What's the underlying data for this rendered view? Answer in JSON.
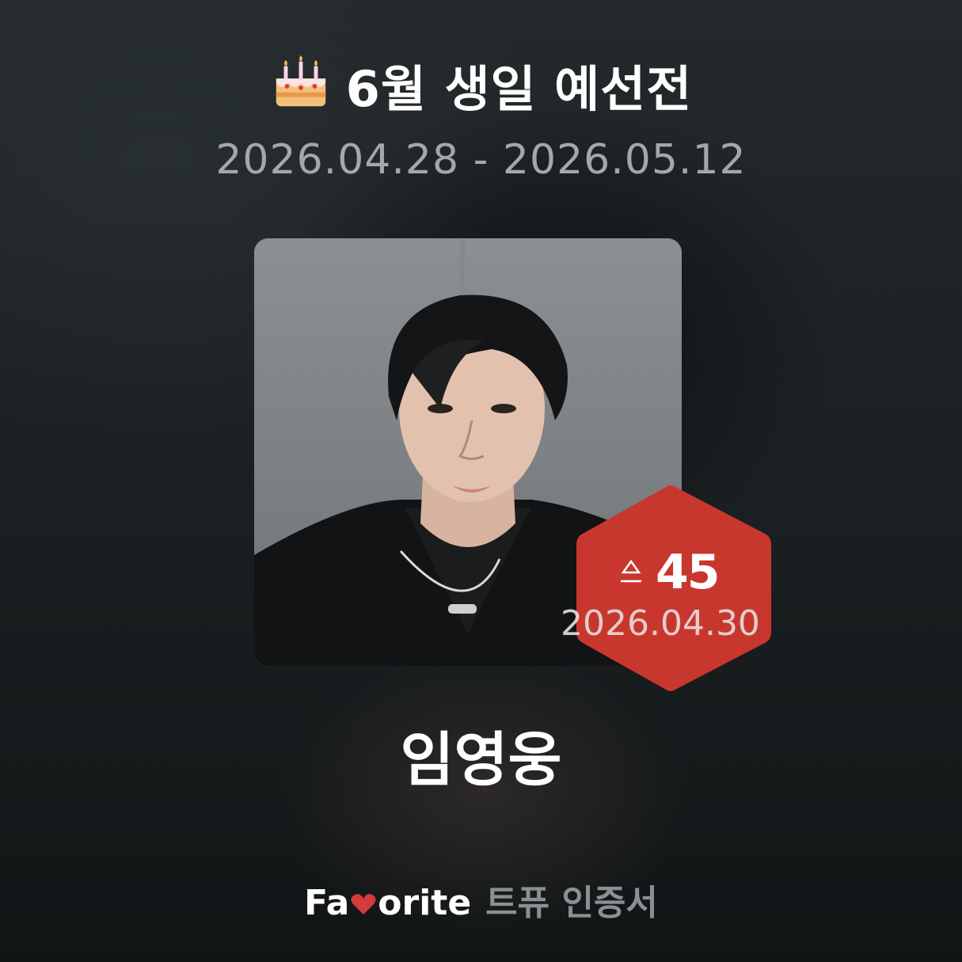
{
  "header": {
    "title": "6월 생일 예선전",
    "title_icon": "birthday-cake-icon",
    "date_range": "2026.04.28 - 2026.05.12"
  },
  "candidate": {
    "name": "임영웅",
    "photo": "portrait-photo"
  },
  "badge": {
    "icon": "vote-icon",
    "votes": "45",
    "date": "2026.04.30",
    "color": "#c8372d"
  },
  "footer": {
    "brand_before": "Fa",
    "brand_heart": "heart-icon",
    "brand_after": "orite",
    "subtitle": "트퓨 인증서"
  },
  "colors": {
    "background": "#1b1f20",
    "muted_text": "#a3a8aa",
    "accent": "#c8372d"
  }
}
